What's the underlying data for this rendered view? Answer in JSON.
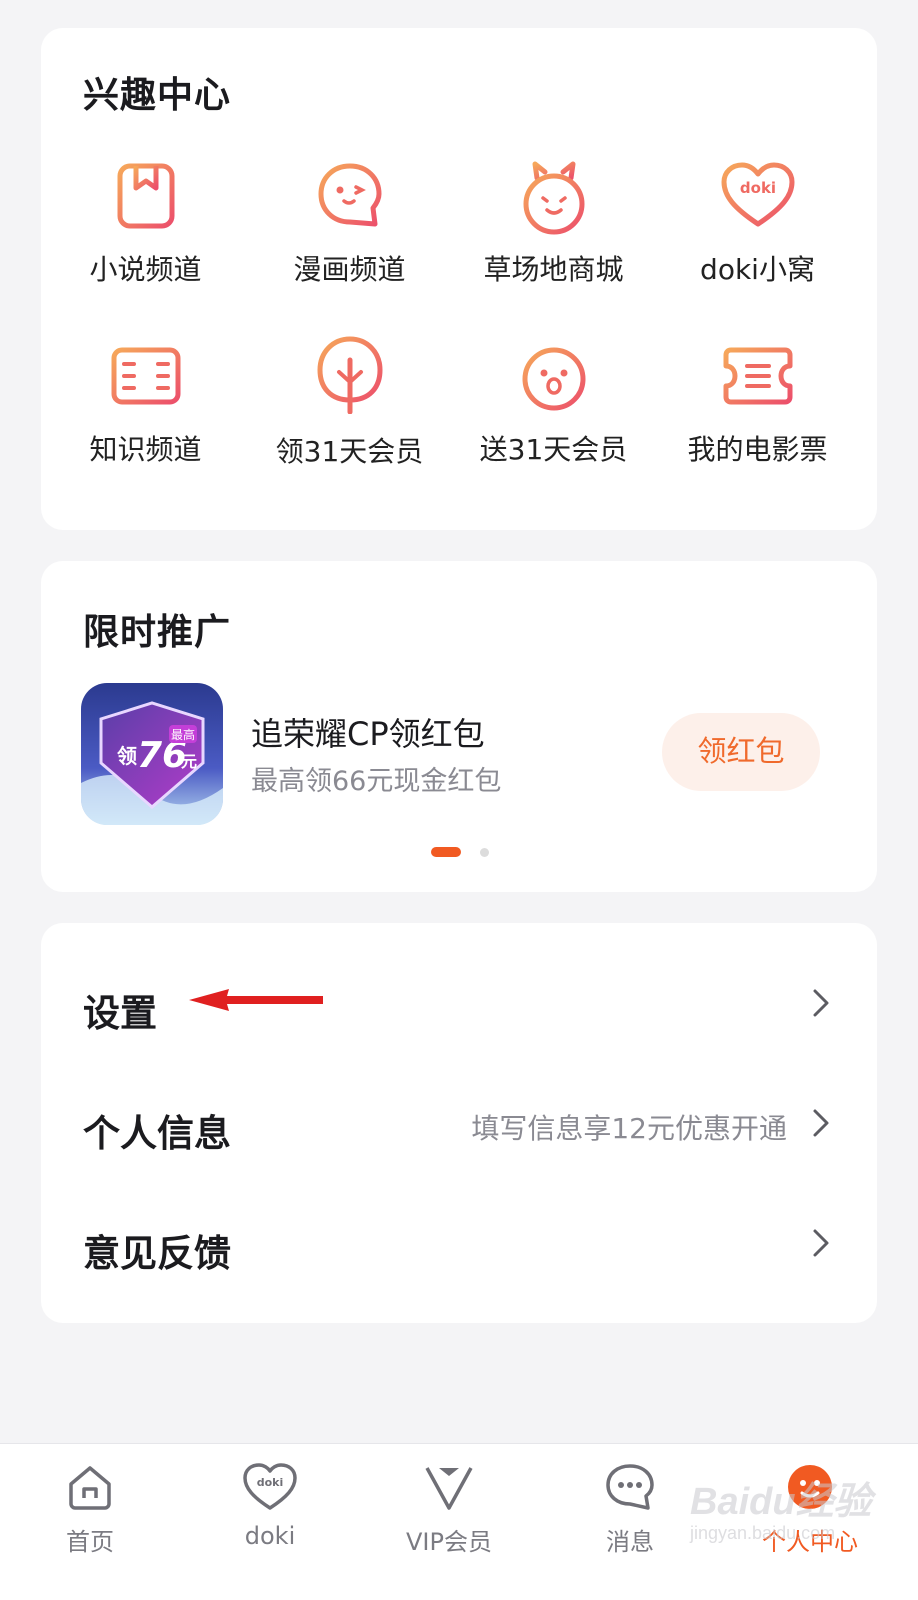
{
  "interest_center": {
    "title": "兴趣中心",
    "items": [
      {
        "label": "小说频道",
        "icon": "book-icon"
      },
      {
        "label": "漫画频道",
        "icon": "comic-bubble-icon"
      },
      {
        "label": "草场地商城",
        "icon": "alpaca-icon"
      },
      {
        "label": "doki小窝",
        "icon": "doki-heart-icon"
      },
      {
        "label": "知识频道",
        "icon": "open-book-icon"
      },
      {
        "label": "领31天会员",
        "icon": "tree-icon"
      },
      {
        "label": "送31天会员",
        "icon": "face-icon"
      },
      {
        "label": "我的电影票",
        "icon": "ticket-icon"
      }
    ],
    "doki_icon_text": "doki"
  },
  "promotion": {
    "title": "限时推广",
    "image_text": {
      "prefix": "领",
      "amount": "76",
      "unit": "元",
      "badge": "最高"
    },
    "item_title": "追荣耀CP领红包",
    "item_subtitle": "最高领66元现金红包",
    "button_label": "领红包",
    "page_count": 2,
    "active_page": 1
  },
  "settings_list": [
    {
      "label": "设置",
      "hint": ""
    },
    {
      "label": "个人信息",
      "hint": "填写信息享12元优惠开通"
    },
    {
      "label": "意见反馈",
      "hint": ""
    }
  ],
  "bottom_nav": [
    {
      "label": "首页",
      "icon": "home-icon",
      "active": false
    },
    {
      "label": "doki",
      "icon": "doki-icon",
      "active": false
    },
    {
      "label": "VIP会员",
      "icon": "vip-icon",
      "active": false
    },
    {
      "label": "消息",
      "icon": "message-icon",
      "active": false
    },
    {
      "label": "个人中心",
      "icon": "profile-icon",
      "active": true
    }
  ],
  "watermark": {
    "text": "Baidu经验",
    "sub": "jingyan.baidu.com"
  },
  "colors": {
    "accent": "#f15a22",
    "icon_gradient_start": "#f3a15b",
    "icon_gradient_end": "#ec4f6b",
    "arrow_annotation": "#e02020"
  }
}
